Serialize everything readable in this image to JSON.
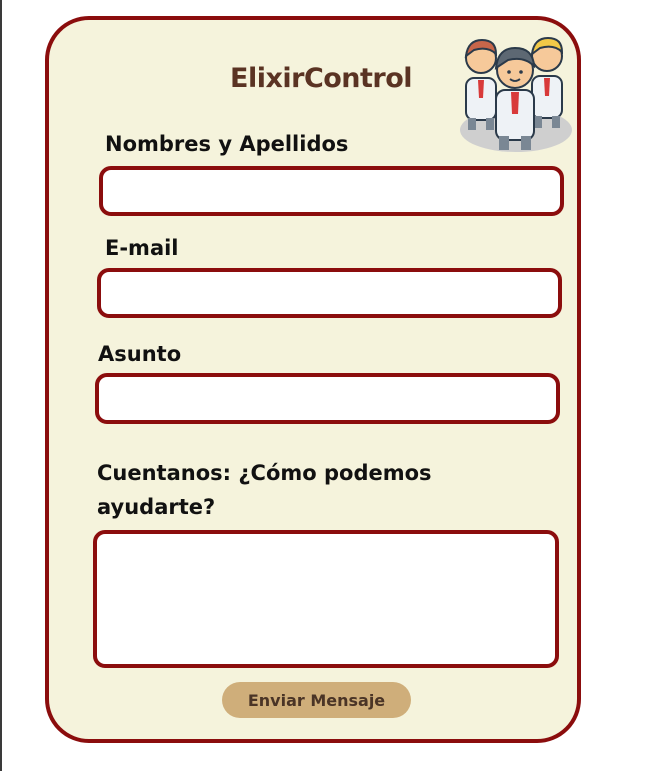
{
  "brand": {
    "name": "ElixirControl"
  },
  "form": {
    "fields": [
      {
        "label": "Nombres y Apellidos",
        "value": "",
        "placeholder": ""
      },
      {
        "label": "E-mail",
        "value": "",
        "placeholder": ""
      },
      {
        "label": "Asunto",
        "value": "",
        "placeholder": ""
      },
      {
        "label": "Cuentanos:  ¿Cómo podemos ayudarte?",
        "value": "",
        "placeholder": ""
      }
    ],
    "submit_label": "Enviar Mensaje"
  },
  "colors": {
    "accent_border": "#8b0d0d",
    "card_background": "#f5f3dc",
    "button_background": "#cfae7a",
    "brand_text": "#5a3323"
  },
  "icons": {
    "team": "team-people-icon"
  }
}
